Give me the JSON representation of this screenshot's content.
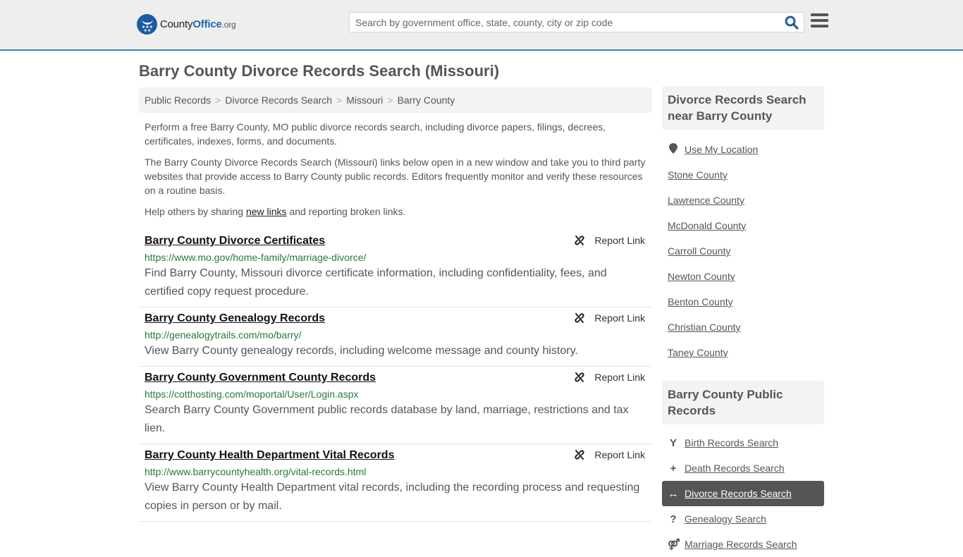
{
  "header": {
    "logo": {
      "county": "County",
      "office": "Office",
      "org": ".org"
    },
    "search_placeholder": "Search by government office, state, county, city or zip code",
    "search_value": ""
  },
  "page": {
    "title": "Barry County Divorce Records Search (Missouri)"
  },
  "breadcrumb": [
    "Public Records",
    "Divorce Records Search",
    "Missouri",
    "Barry County"
  ],
  "intro": {
    "p1": "Perform a free Barry County, MO public divorce records search, including divorce papers, filings, decrees, certificates, indexes, forms, and documents.",
    "p2": "The Barry County Divorce Records Search (Missouri) links below open in a new window and take you to third party websites that provide access to Barry County public records. Editors frequently monitor and verify these resources on a routine basis.",
    "p3_before": "Help others by sharing ",
    "p3_link": "new links",
    "p3_after": " and reporting broken links."
  },
  "report_label": "Report Link",
  "results": [
    {
      "title": "Barry County Divorce Certificates",
      "url": "https://www.mo.gov/home-family/marriage-divorce/",
      "desc": "Find Barry County, Missouri divorce certificate information, including confidentiality, fees, and certified copy request procedure."
    },
    {
      "title": "Barry County Genealogy Records",
      "url": "http://genealogytrails.com/mo/barry/",
      "desc": "View Barry County genealogy records, including welcome message and county history."
    },
    {
      "title": "Barry County Government County Records",
      "url": "https://cotthosting.com/moportal/User/Login.aspx",
      "desc": "Search Barry County Government public records database by land, marriage, restrictions and tax lien."
    },
    {
      "title": "Barry County Health Department Vital Records",
      "url": "http://www.barrycountyhealth.org/vital-records.html",
      "desc": "View Barry County Health Department vital records, including the recording process and requesting copies in person or by mail."
    }
  ],
  "sidebar": {
    "nearby_heading": "Divorce Records Search near Barry County",
    "use_location": "Use My Location",
    "nearby": [
      "Stone County",
      "Lawrence County",
      "McDonald County",
      "Carroll County",
      "Newton County",
      "Benton County",
      "Christian County",
      "Taney County"
    ],
    "public_heading": "Barry County Public Records",
    "public": [
      {
        "label": "Birth Records Search",
        "icon": "child-icon",
        "glyph": "Y",
        "active": false
      },
      {
        "label": "Death Records Search",
        "icon": "plus-icon",
        "glyph": "+",
        "active": false
      },
      {
        "label": "Divorce Records Search",
        "icon": "arrows-horizontal-icon",
        "glyph": "↔",
        "active": true
      },
      {
        "label": "Genealogy Search",
        "icon": "question-icon",
        "glyph": "?",
        "active": false
      },
      {
        "label": "Marriage Records Search",
        "icon": "venus-mars-icon",
        "glyph": "⚤",
        "active": false
      }
    ]
  },
  "colors": {
    "accent": "#3a7fb5",
    "brand_blue": "#1f66b3",
    "url_green": "#247a3a",
    "active_bg": "#555555"
  }
}
